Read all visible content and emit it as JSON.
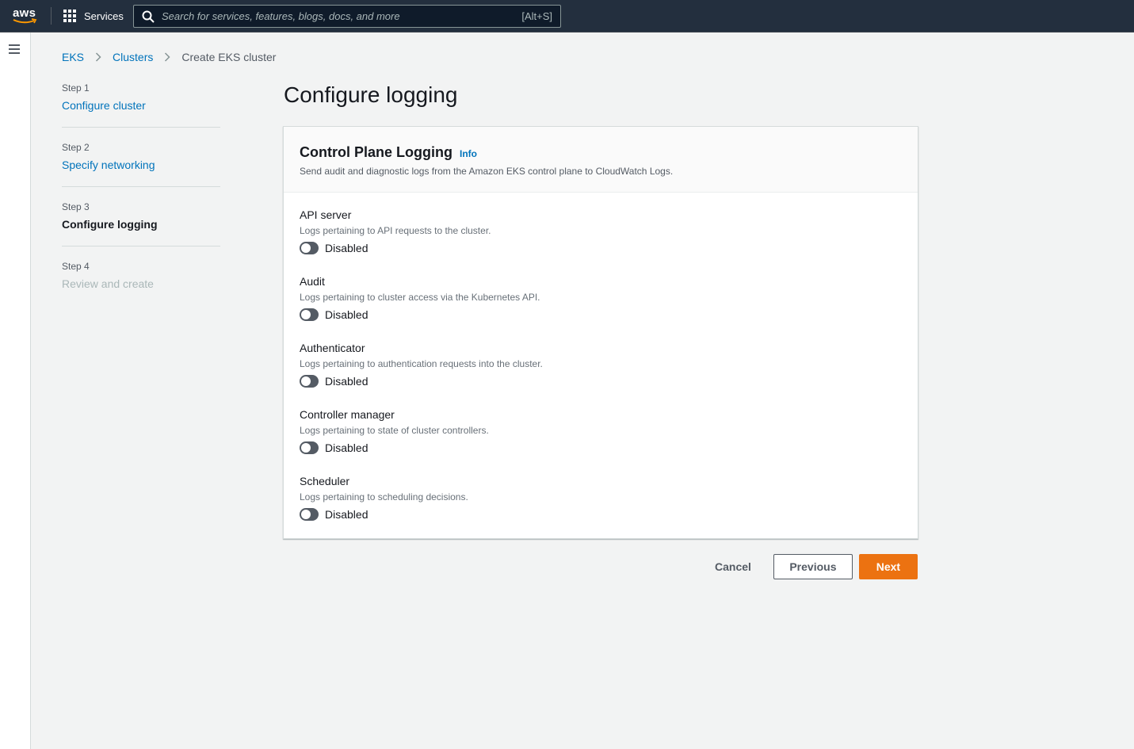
{
  "topnav": {
    "logo_text": "aws",
    "services_label": "Services",
    "search_placeholder": "Search for services, features, blogs, docs, and more",
    "search_shortcut": "[Alt+S]"
  },
  "breadcrumb": {
    "items": [
      "EKS",
      "Clusters"
    ],
    "current": "Create EKS cluster"
  },
  "steps": [
    {
      "number": "Step 1",
      "title": "Configure cluster",
      "state": "link"
    },
    {
      "number": "Step 2",
      "title": "Specify networking",
      "state": "link"
    },
    {
      "number": "Step 3",
      "title": "Configure logging",
      "state": "current"
    },
    {
      "number": "Step 4",
      "title": "Review and create",
      "state": "disabled"
    }
  ],
  "page": {
    "title": "Configure logging"
  },
  "panel": {
    "title": "Control Plane Logging",
    "info_label": "Info",
    "description": "Send audit and diagnostic logs from the Amazon EKS control plane to CloudWatch Logs."
  },
  "log_types": [
    {
      "name": "API server",
      "description": "Logs pertaining to API requests to the cluster.",
      "status": "Disabled"
    },
    {
      "name": "Audit",
      "description": "Logs pertaining to cluster access via the Kubernetes API.",
      "status": "Disabled"
    },
    {
      "name": "Authenticator",
      "description": "Logs pertaining to authentication requests into the cluster.",
      "status": "Disabled"
    },
    {
      "name": "Controller manager",
      "description": "Logs pertaining to state of cluster controllers.",
      "status": "Disabled"
    },
    {
      "name": "Scheduler",
      "description": "Logs pertaining to scheduling decisions.",
      "status": "Disabled"
    }
  ],
  "actions": {
    "cancel_label": "Cancel",
    "previous_label": "Previous",
    "next_label": "Next"
  },
  "colors": {
    "nav_bg": "#232f3e",
    "link": "#0073bb",
    "primary_button": "#ec7211",
    "toggle_off": "#545b64"
  },
  "icons": [
    "aws-logo",
    "grid-icon",
    "search-icon",
    "hamburger-icon",
    "chevron-right-icon"
  ]
}
